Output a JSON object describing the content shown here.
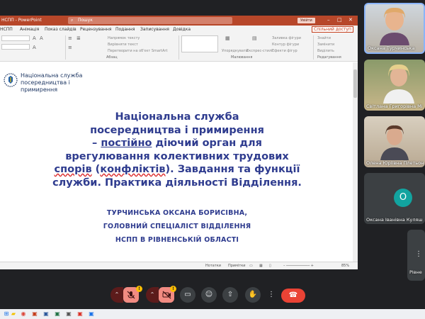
{
  "ppt": {
    "app_title": "НСПП - PowerPoint",
    "search_placeholder": "Пошук",
    "signin": "Увійти",
    "share": "Спільний доступ",
    "tabs": [
      "НСПП",
      "Анімація",
      "Показ слайдів",
      "Рецензування",
      "Подання",
      "Записування",
      "Довідка"
    ],
    "ribbon": {
      "groups": [
        "Абзац",
        "Малювання",
        "Редагування"
      ],
      "items": [
        "Напрямок тексту",
        "Вирівняти текст",
        "Перетворити на об'єкт SmartArt",
        "Упорядкувати",
        "Експрес-стилі",
        "Заливка фігури",
        "Контур фігури",
        "Ефекти фігур",
        "Знайти",
        "Замінити",
        "Виділить"
      ]
    },
    "status": {
      "notes": "Нотатки",
      "comments": "Примітки",
      "zoom": "85%"
    }
  },
  "slide": {
    "logo_lines": [
      "Національна служба",
      "посередництва і",
      "примирення"
    ],
    "title_l1": "Національна служба",
    "title_l2": "посередництва і примирення",
    "title_l3_a": "– ",
    "title_l3_b": "постійно",
    "title_l3_c": " діючий орган для",
    "title_l4": "врегулювання колективних трудових",
    "title_l5_a": "спорів",
    "title_l5_b": " (",
    "title_l5_c": "конфліктів",
    "title_l5_d": "). Завдання та функції",
    "title_l6": "служби. Практика діяльності Відділення.",
    "subtitle": [
      "ТУРЧИНСЬКА ОКСАНА БОРИСІВНА,",
      "ГОЛОВНИЙ СПЕЦІАЛІСТ ВІДДІЛЕННЯ",
      "НСПП В РІВНЕНСЬКІЙ ОБЛАСТІ"
    ]
  },
  "participants": [
    {
      "name": "Оксана Турчинська"
    },
    {
      "name": "Світлана Григорівна Мі"
    },
    {
      "name": "Олена Юріївна Плетьон"
    },
    {
      "name": "Оксана Іванівна Куляш",
      "initial": "О"
    },
    {
      "name": "Рівне"
    }
  ],
  "colors": {
    "ppt_accent": "#b7472a",
    "slide_title": "#2f3c8f",
    "hangup": "#ea4335",
    "avatar": "#12a4a0"
  },
  "controls": {
    "warn": "!",
    "icons": [
      "chevron-up-icon",
      "mic-off-icon",
      "camera-off-icon",
      "captions-icon",
      "emoji-icon",
      "present-icon",
      "raise-hand-icon",
      "more-icon",
      "hangup-icon"
    ]
  }
}
